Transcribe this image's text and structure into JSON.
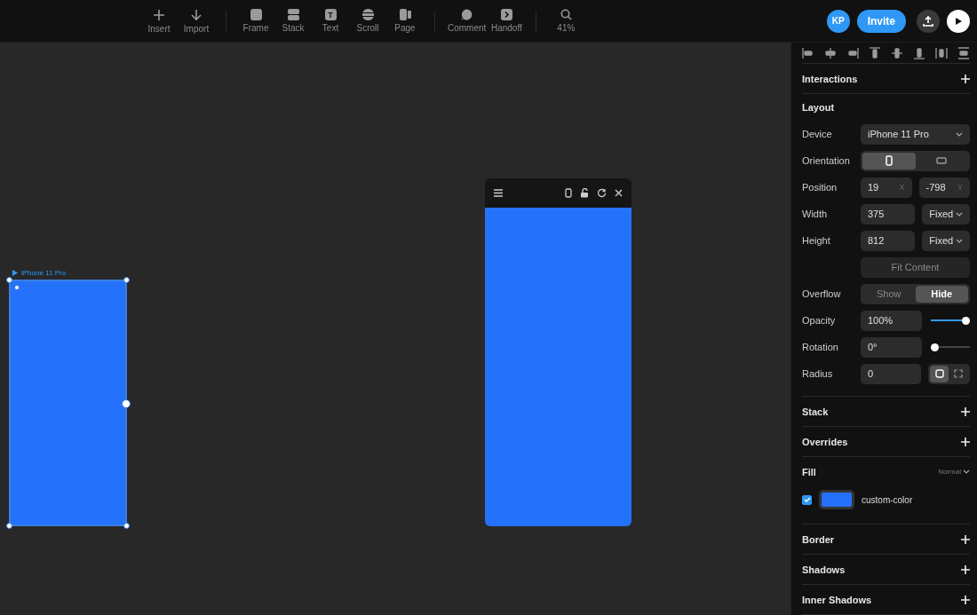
{
  "toolbar": {
    "tool_groups": [
      [
        {
          "label": "Insert"
        },
        {
          "label": "Import"
        }
      ],
      [
        {
          "label": "Frame"
        },
        {
          "label": "Stack"
        },
        {
          "label": "Text",
          "glyph": "T"
        },
        {
          "label": "Scroll"
        },
        {
          "label": "Page"
        }
      ],
      [
        {
          "label": "Comment"
        },
        {
          "label": "Handoff"
        }
      ],
      [
        {
          "label": "41%"
        }
      ]
    ],
    "avatar": "KP",
    "invite": "Invite"
  },
  "canvas": {
    "frame": {
      "label": "iPhone 11 Pro",
      "selected": true,
      "color": "#2472fc"
    },
    "preview": {
      "color": "#2472fc"
    }
  },
  "panel": {
    "sections": [
      {
        "kind": "header",
        "title": "Interactions"
      },
      {
        "kind": "layout",
        "title": "Layout",
        "rows": [
          {
            "kind": "select",
            "label": "Device",
            "value": "iPhone 11 Pro"
          },
          {
            "kind": "icon-toggle",
            "label": "Orientation",
            "options": [
              {
                "selected": true
              },
              {
                "selected": false
              }
            ]
          },
          {
            "kind": "pair",
            "label": "Position",
            "values": [
              {
                "value": "19",
                "unit": "X"
              },
              {
                "value": "-798",
                "unit": "Y"
              }
            ]
          },
          {
            "kind": "size",
            "label": "Width",
            "value": "375",
            "mode": "Fixed"
          },
          {
            "kind": "size",
            "label": "Height",
            "value": "812",
            "mode": "Fixed"
          },
          {
            "kind": "button",
            "label": "",
            "button": "Fit Content"
          },
          {
            "kind": "text-toggle",
            "label": "Overflow",
            "options": [
              {
                "label": "Show",
                "selected": false
              },
              {
                "label": "Hide",
                "selected": true
              }
            ]
          },
          {
            "kind": "slider",
            "label": "Opacity",
            "value": "100%",
            "level": 1
          },
          {
            "kind": "slider",
            "label": "Rotation",
            "value": "0°",
            "level": 0
          },
          {
            "kind": "radius",
            "label": "Radius",
            "value": "0",
            "options": [
              {
                "selected": true
              },
              {
                "selected": false
              }
            ]
          }
        ]
      },
      {
        "kind": "header",
        "title": "Stack"
      },
      {
        "kind": "header",
        "title": "Overrides"
      },
      {
        "kind": "fill",
        "title": "Fill",
        "blend": "Normal",
        "checked": true,
        "color": "#2472fc",
        "name": "custom-color"
      },
      {
        "kind": "header",
        "title": "Border"
      },
      {
        "kind": "header",
        "title": "Shadows"
      },
      {
        "kind": "header",
        "title": "Inner Shadows"
      }
    ]
  }
}
